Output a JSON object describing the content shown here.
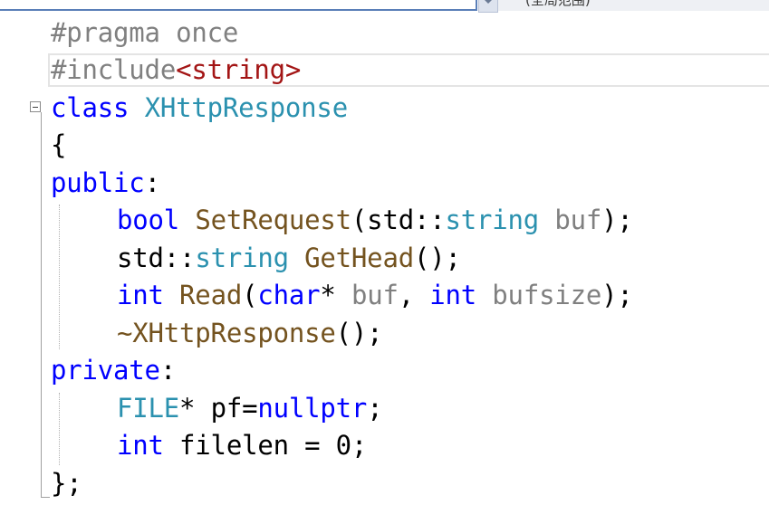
{
  "top_bar": {
    "scope_text": "(全局范围)"
  },
  "code": {
    "line1": {
      "directive": "#pragma",
      "rest": " once"
    },
    "line2": {
      "directive": "#include",
      "header": "<string>"
    },
    "line3": {
      "keyword": "class",
      "space": " ",
      "name": "XHttpResponse"
    },
    "line4": {
      "text": "{"
    },
    "line5": {
      "keyword": "public",
      "colon": ":"
    },
    "line6": {
      "ret": "bool",
      "sp": " ",
      "func": "SetRequest",
      "open": "(std::",
      "type": "string",
      "sp2": " ",
      "param": "buf",
      "close": ");"
    },
    "line7": {
      "ns": "std::",
      "type": "string",
      "sp": " ",
      "func": "GetHead",
      "rest": "();"
    },
    "line8": {
      "ret": "int",
      "sp": " ",
      "func": "Read",
      "open": "(",
      "type1": "char",
      "mid1": "* ",
      "param1": "buf",
      "comma": ", ",
      "type2": "int",
      "sp2": " ",
      "param2": "bufsize",
      "close": ");"
    },
    "line9": {
      "func": "~XHttpResponse",
      "rest": "();"
    },
    "line10": {
      "keyword": "private",
      "colon": ":"
    },
    "line11": {
      "type": "FILE",
      "mid": "* pf=",
      "value": "nullptr",
      "end": ";"
    },
    "line12": {
      "type": "int",
      "rest": " filelen = 0;"
    },
    "line13": {
      "text": "};"
    }
  }
}
